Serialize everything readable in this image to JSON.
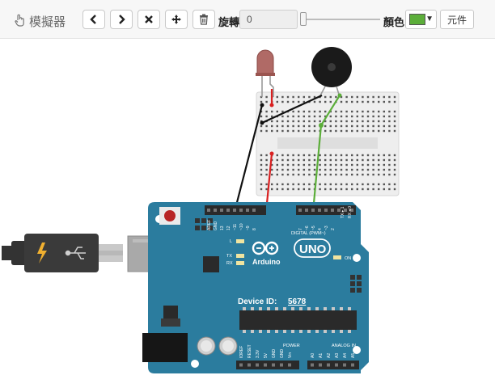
{
  "toolbar": {
    "app_title": "模擬器",
    "rotate_label": "旋轉",
    "rotate_value": "0",
    "color_label": "顏色",
    "color_value": "#5cae3a",
    "components_label": "元件",
    "buttons": [
      "undo",
      "redo",
      "delete",
      "pan",
      "trash"
    ]
  },
  "board": {
    "device_id_label": "Device ID:",
    "device_id_value": "5678",
    "logo_text": "Arduino",
    "uno_text": "UNO",
    "on_label": "ON",
    "digital_label": "DIGITAL (PWM~)",
    "analog_label": "ANALOG IN",
    "power_label": "POWER",
    "led_labels": [
      "L",
      "TX",
      "RX"
    ],
    "tx_rx_labels": [
      "TX ▸ 1",
      "RX ◂ 0"
    ],
    "top_pins": [
      "AREF",
      "GND",
      "13",
      "12",
      "~11",
      "~10",
      "~9",
      "8",
      "7",
      "~6",
      "~5",
      "4",
      "~3",
      "2"
    ],
    "power_pins": [
      "IOREF",
      "RESET",
      "3.3V",
      "5V",
      "GND",
      "GND",
      "Vin"
    ],
    "analog_pins": [
      "A0",
      "A1",
      "A2",
      "A3",
      "A4",
      "A5"
    ]
  },
  "colors": {
    "board": "#2b7c9e",
    "wire_red": "#d92020",
    "wire_black": "#111111",
    "wire_green": "#5cae3a"
  }
}
